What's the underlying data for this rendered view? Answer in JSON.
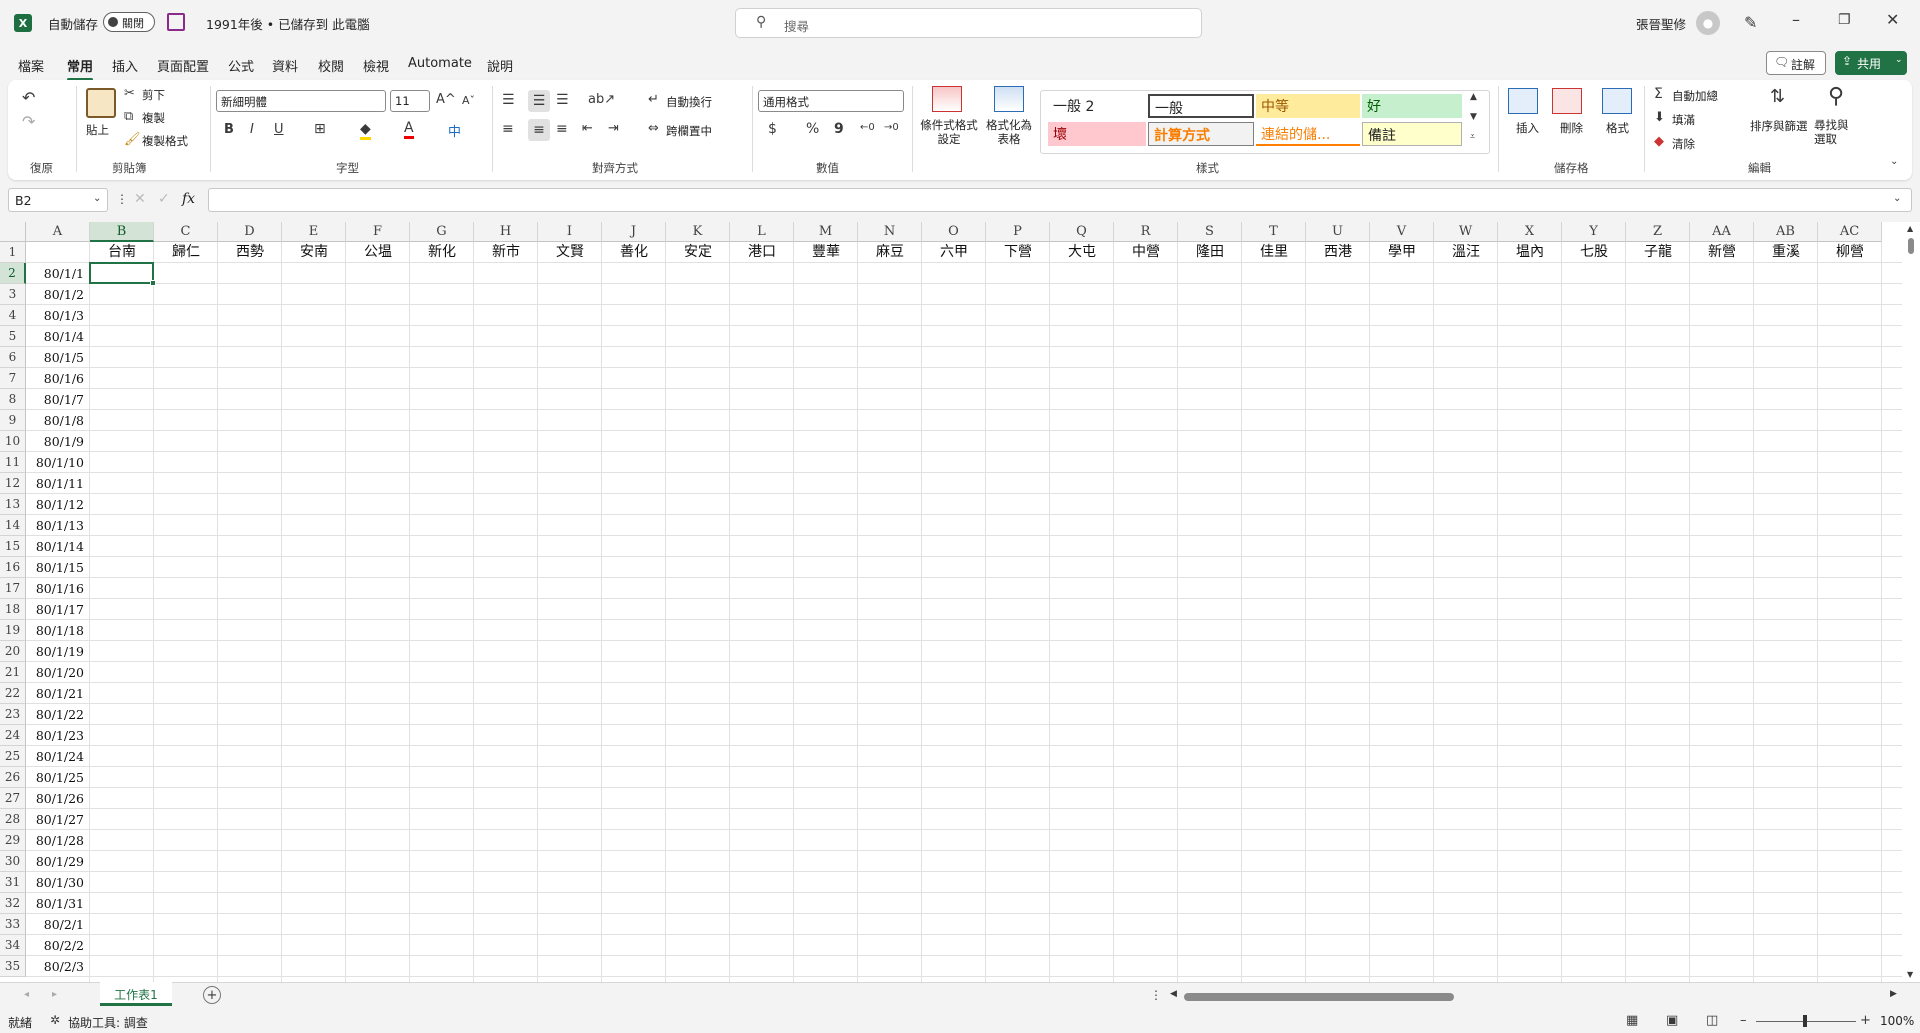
{
  "titlebar": {
    "autosave_label": "自動儲存",
    "autosave_state": "關閉",
    "doc_title": "1991年後 • 已儲存到 此電腦",
    "search_placeholder": "搜尋",
    "user_name": "張晉聖修"
  },
  "menu": [
    "檔案",
    "常用",
    "插入",
    "頁面配置",
    "公式",
    "資料",
    "校閱",
    "檢視",
    "Automate",
    "說明"
  ],
  "menu_active": "常用",
  "menu_right": {
    "comments": "註解",
    "share": "共用"
  },
  "ribbon": {
    "undo_group": "復原",
    "clipboard": {
      "label": "剪貼簿",
      "paste": "貼上",
      "cut": "剪下",
      "copy": "複製",
      "format_painter": "複製格式"
    },
    "font": {
      "label": "字型",
      "font_name": "新細明體",
      "font_size": "11"
    },
    "align": {
      "label": "對齊方式",
      "wrap": "自動換行",
      "merge": "跨欄置中"
    },
    "number": {
      "label": "數值",
      "format": "通用格式"
    },
    "cond_format": "條件式格式設定",
    "format_table": "格式化為表格",
    "styles": {
      "label": "樣式",
      "cells": [
        "一般 2",
        "一般",
        "中等",
        "好",
        "壞",
        "計算方式",
        "連結的儲...",
        "備註"
      ]
    },
    "cells": {
      "label": "儲存格",
      "insert": "插入",
      "delete": "刪除",
      "format": "格式"
    },
    "editing": {
      "label": "編輯",
      "autosum": "自動加總",
      "fill": "填滿",
      "clear": "清除",
      "sort": "排序與篩選",
      "find": "尋找與選取"
    }
  },
  "formula": {
    "name_box": "B2",
    "fx": "fx",
    "content": ""
  },
  "columns": [
    "A",
    "B",
    "C",
    "D",
    "E",
    "F",
    "G",
    "H",
    "I",
    "J",
    "K",
    "L",
    "M",
    "N",
    "O",
    "P",
    "Q",
    "R",
    "S",
    "T",
    "U",
    "V",
    "W",
    "X",
    "Y",
    "Z",
    "AA",
    "AB",
    "AC"
  ],
  "row1_headers": [
    "台南",
    "歸仁",
    "西勢",
    "安南",
    "公塭",
    "新化",
    "新市",
    "文賢",
    "善化",
    "安定",
    "港口",
    "豐華",
    "麻豆",
    "六甲",
    "下營",
    "大屯",
    "中營",
    "隆田",
    "佳里",
    "西港",
    "學甲",
    "溫汪",
    "塭內",
    "七股",
    "子龍",
    "新營",
    "重溪",
    "柳營"
  ],
  "rows": [
    "1",
    "2",
    "3",
    "4",
    "5",
    "6",
    "7",
    "8",
    "9",
    "10",
    "11",
    "12",
    "13",
    "14",
    "15",
    "16",
    "17",
    "18",
    "19",
    "20",
    "21",
    "22",
    "23",
    "24",
    "25",
    "26",
    "27",
    "28",
    "29",
    "30",
    "31",
    "32",
    "33",
    "34",
    "35"
  ],
  "dates": [
    "80/1/1",
    "80/1/2",
    "80/1/3",
    "80/1/4",
    "80/1/5",
    "80/1/6",
    "80/1/7",
    "80/1/8",
    "80/1/9",
    "80/1/10",
    "80/1/11",
    "80/1/12",
    "80/1/13",
    "80/1/14",
    "80/1/15",
    "80/1/16",
    "80/1/17",
    "80/1/18",
    "80/1/19",
    "80/1/20",
    "80/1/21",
    "80/1/22",
    "80/1/23",
    "80/1/24",
    "80/1/25",
    "80/1/26",
    "80/1/27",
    "80/1/28",
    "80/1/29",
    "80/1/30",
    "80/1/31",
    "80/2/1",
    "80/2/2",
    "80/2/3"
  ],
  "sheet_tab": "工作表1",
  "status": {
    "ready": "就緒",
    "accessibility": "協助工具: 調查",
    "zoom": "100%"
  },
  "colors": {
    "accent": "#217346",
    "selected_header": "#d3e3d6"
  }
}
